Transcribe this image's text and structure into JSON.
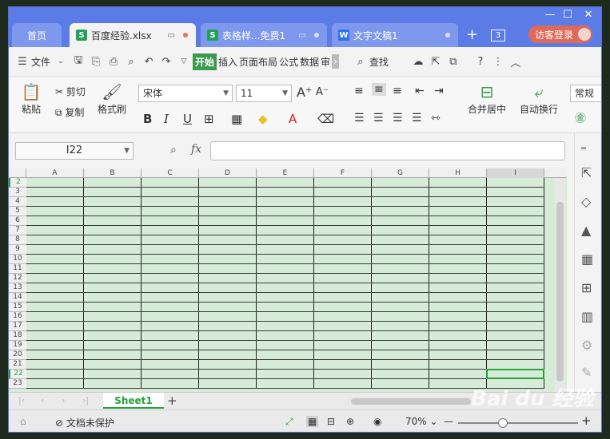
{
  "tabs": {
    "home": "首页",
    "active": {
      "label": "百度经验.xlsx",
      "icon": "S"
    },
    "t2": {
      "label": "表格样...免费1",
      "icon": "S"
    },
    "t3": {
      "label": "文字文稿1",
      "icon": "W"
    },
    "count": "3",
    "visitor": "访客登录"
  },
  "menu": {
    "file": "文件",
    "items": [
      "开始",
      "插入",
      "页面布局",
      "公式",
      "数据",
      "审"
    ],
    "find": "查找"
  },
  "ribbon": {
    "paste": "粘贴",
    "cut": "剪切",
    "copy": "复制",
    "format_painter": "格式刷",
    "font_name": "宋体",
    "font_size": "11",
    "merge": "合并居中",
    "wrap": "自动换行",
    "number_format": "常规"
  },
  "formula_bar": {
    "name_box": "I22",
    "fx": "fx",
    "value": ""
  },
  "grid": {
    "columns": [
      "A",
      "B",
      "C",
      "D",
      "E",
      "F",
      "G",
      "H",
      "I"
    ],
    "rows": [
      "2",
      "3",
      "4",
      "5",
      "6",
      "7",
      "8",
      "9",
      "10",
      "11",
      "12",
      "13",
      "14",
      "15",
      "16",
      "17",
      "18",
      "19",
      "20",
      "21",
      "22",
      "23"
    ],
    "selected_cell": "I22",
    "fill_color": "#d6ecd8"
  },
  "sheets": {
    "names": [
      "Sheet1"
    ],
    "active": "Sheet1"
  },
  "status": {
    "protection": "文档未保护",
    "zoom": "70%"
  },
  "colors": {
    "accent": "#5b7ce6",
    "green": "#27a03c",
    "visitor": "#e06a5a"
  },
  "watermark": "Baidu经验"
}
